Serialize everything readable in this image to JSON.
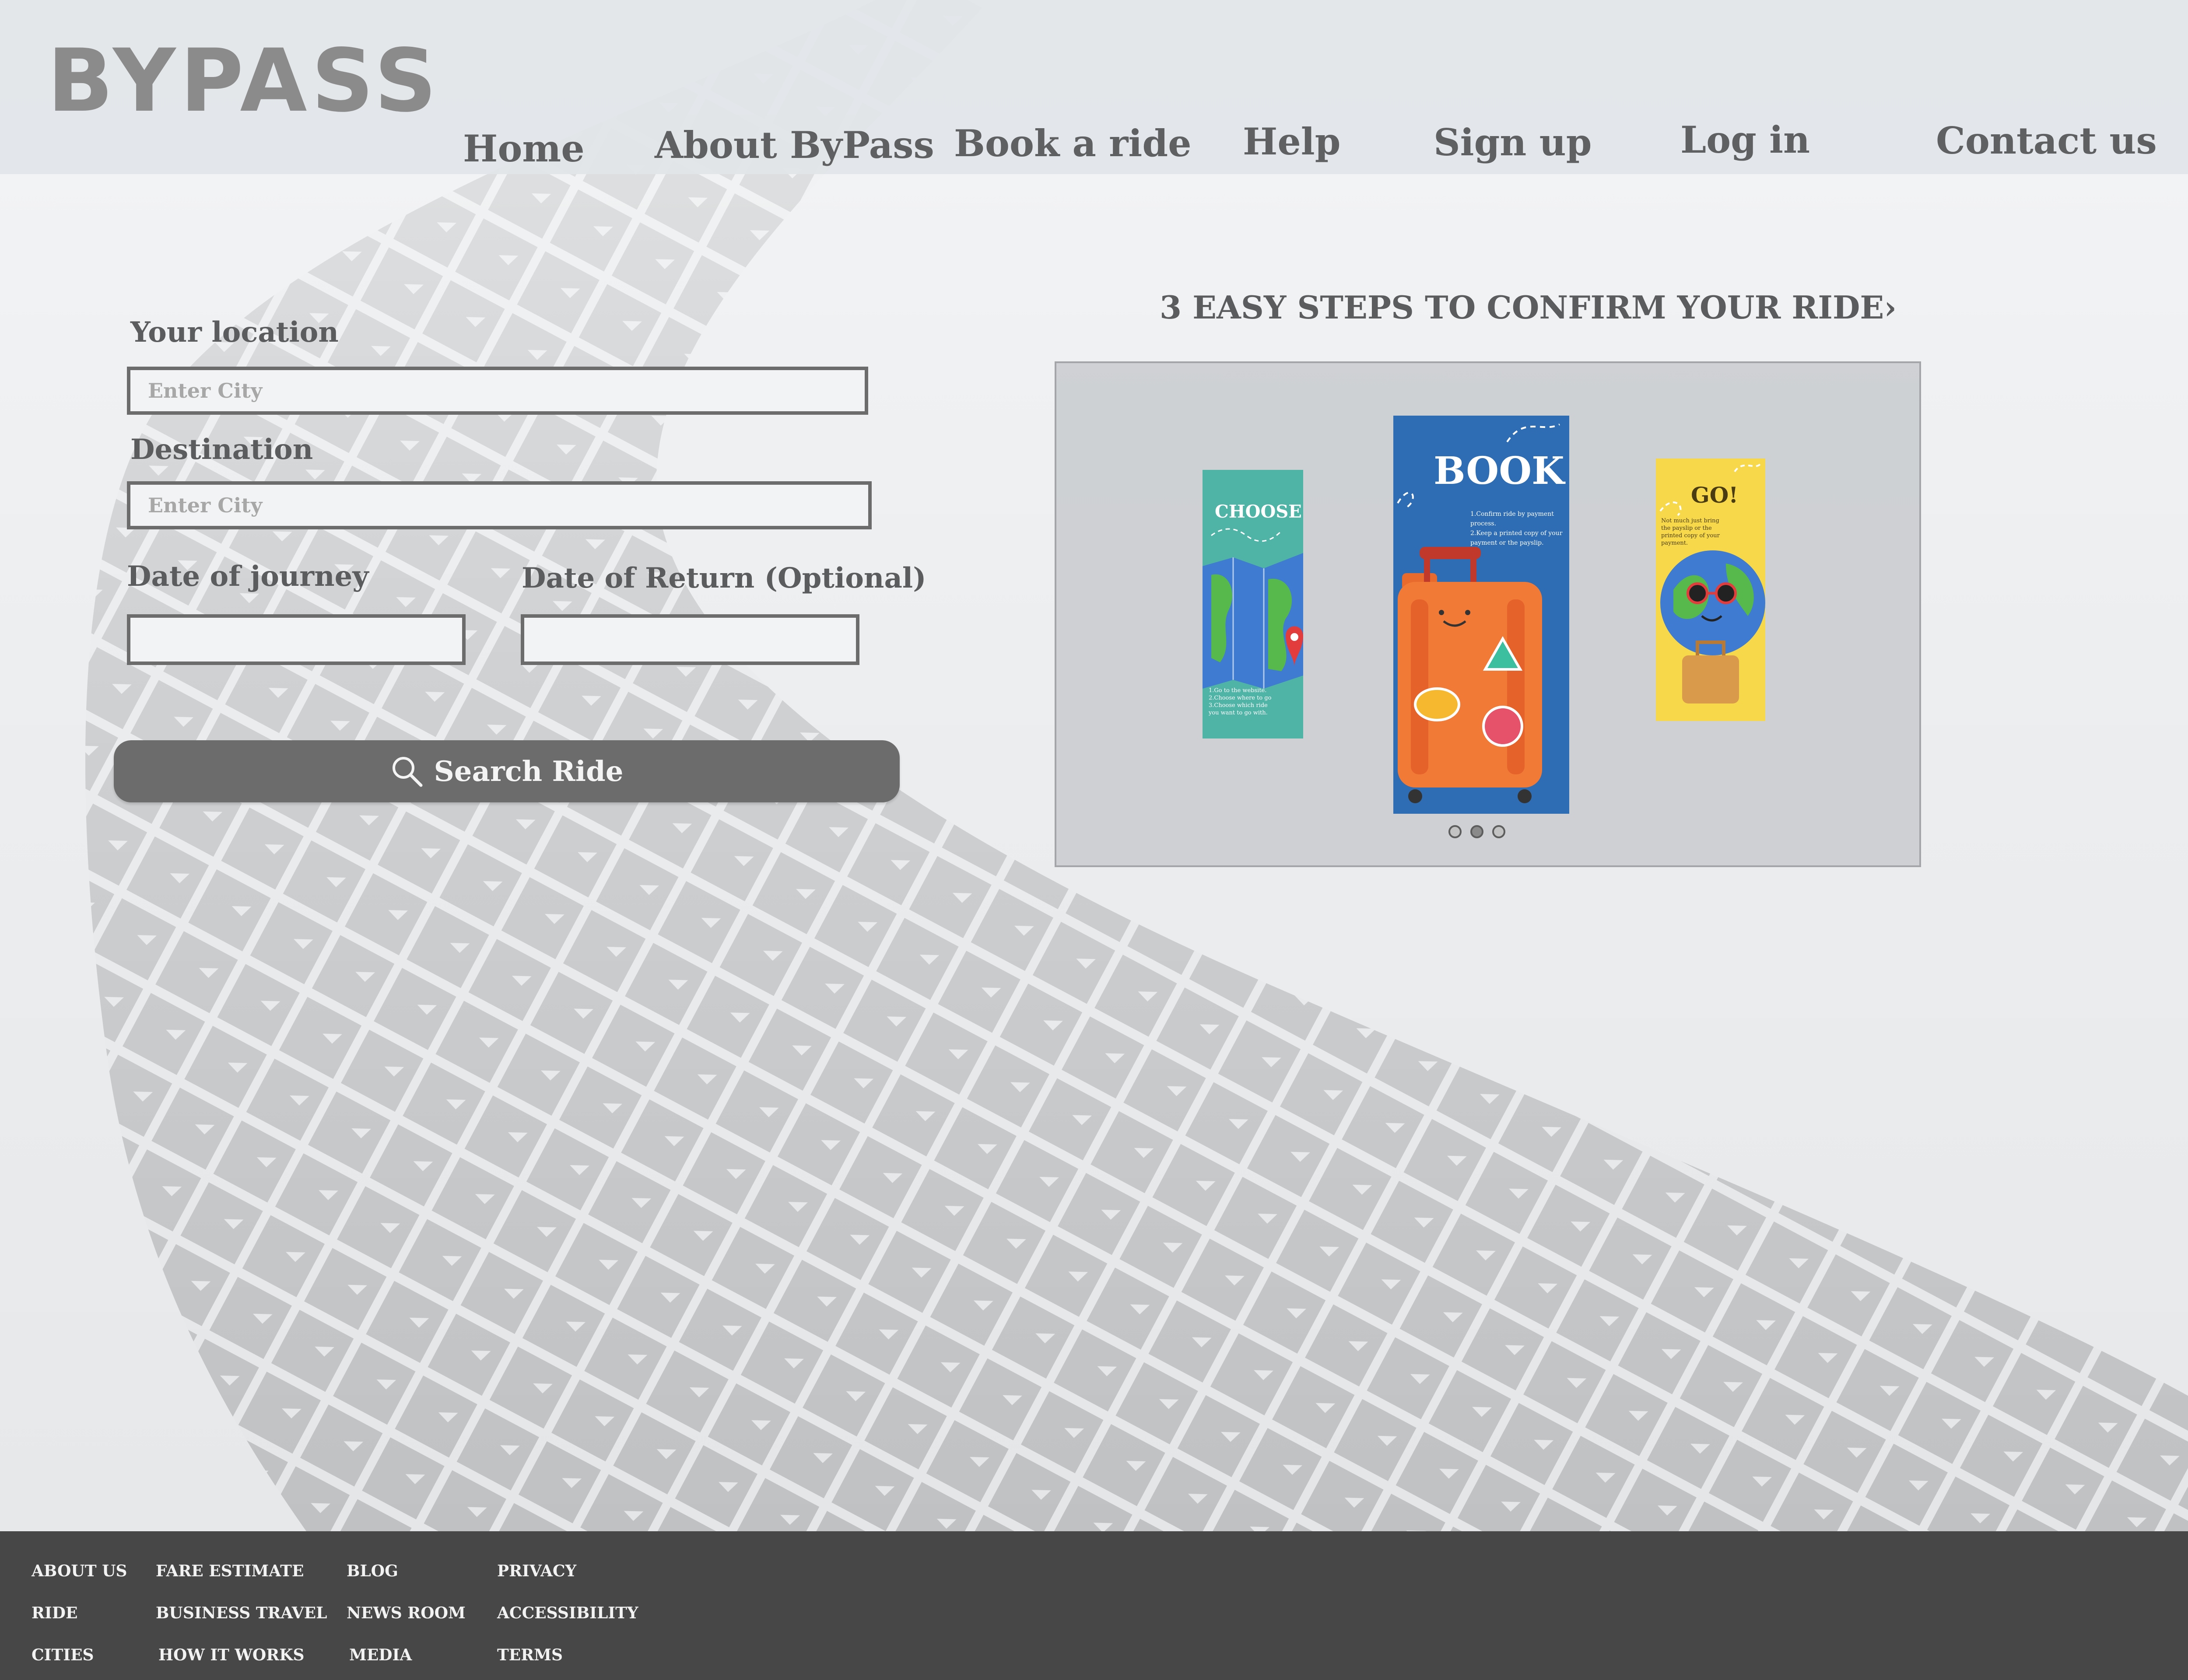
{
  "brand": {
    "logo": "BYPASS"
  },
  "nav": {
    "home": "Home",
    "about": "About ByPass",
    "book": "Book a ride",
    "help": "Help",
    "signup": "Sign up",
    "login": "Log in",
    "contact": "Contact us"
  },
  "form": {
    "location_label": "Your location",
    "location_placeholder": "Enter City",
    "destination_label": "Destination",
    "destination_placeholder": "Enter City",
    "journey_label": "Date of journey",
    "return_label": "Date of Return (Optional)",
    "search_label": "Search Ride"
  },
  "steps": {
    "title": "3 EASY STEPS TO CONFIRM YOUR RIDE",
    "chevron": "›",
    "choose": {
      "title": "CHOOSE",
      "lines": [
        "1.Go to the website.",
        "2.Choose where to go",
        "3.Choose which ride",
        "you want to go with."
      ],
      "bg": "#4fb3a5"
    },
    "book": {
      "title": "BOOK",
      "lines": [
        "1.Confirm ride by payment",
        "process.",
        "2.Keep a printed copy of your",
        "payment or the payslip."
      ],
      "bg": "#2e6db3"
    },
    "go": {
      "title": "GO!",
      "lines": [
        "Not much just bring",
        "the payslip or the",
        "printed copy of your",
        "payment."
      ],
      "bg": "#f6d84a"
    },
    "active_slide": 2,
    "slide_count": 3
  },
  "footer": {
    "col1": [
      "ABOUT US",
      "RIDE",
      "CITIES"
    ],
    "col2": [
      "FARE ESTIMATE",
      "BUSINESS TRAVEL",
      "HOW  IT WORKS"
    ],
    "col3": [
      "BLOG",
      "NEWS ROOM",
      "MEDIA"
    ],
    "col4": [
      "PRIVACY",
      "ACCESSIBILITY",
      "TERMS"
    ]
  },
  "colors": {
    "background": "#e6e8ea",
    "track": "#b9bbbd",
    "button": "#6c6c6c",
    "footer": "#474747",
    "text": "#5f6062"
  }
}
